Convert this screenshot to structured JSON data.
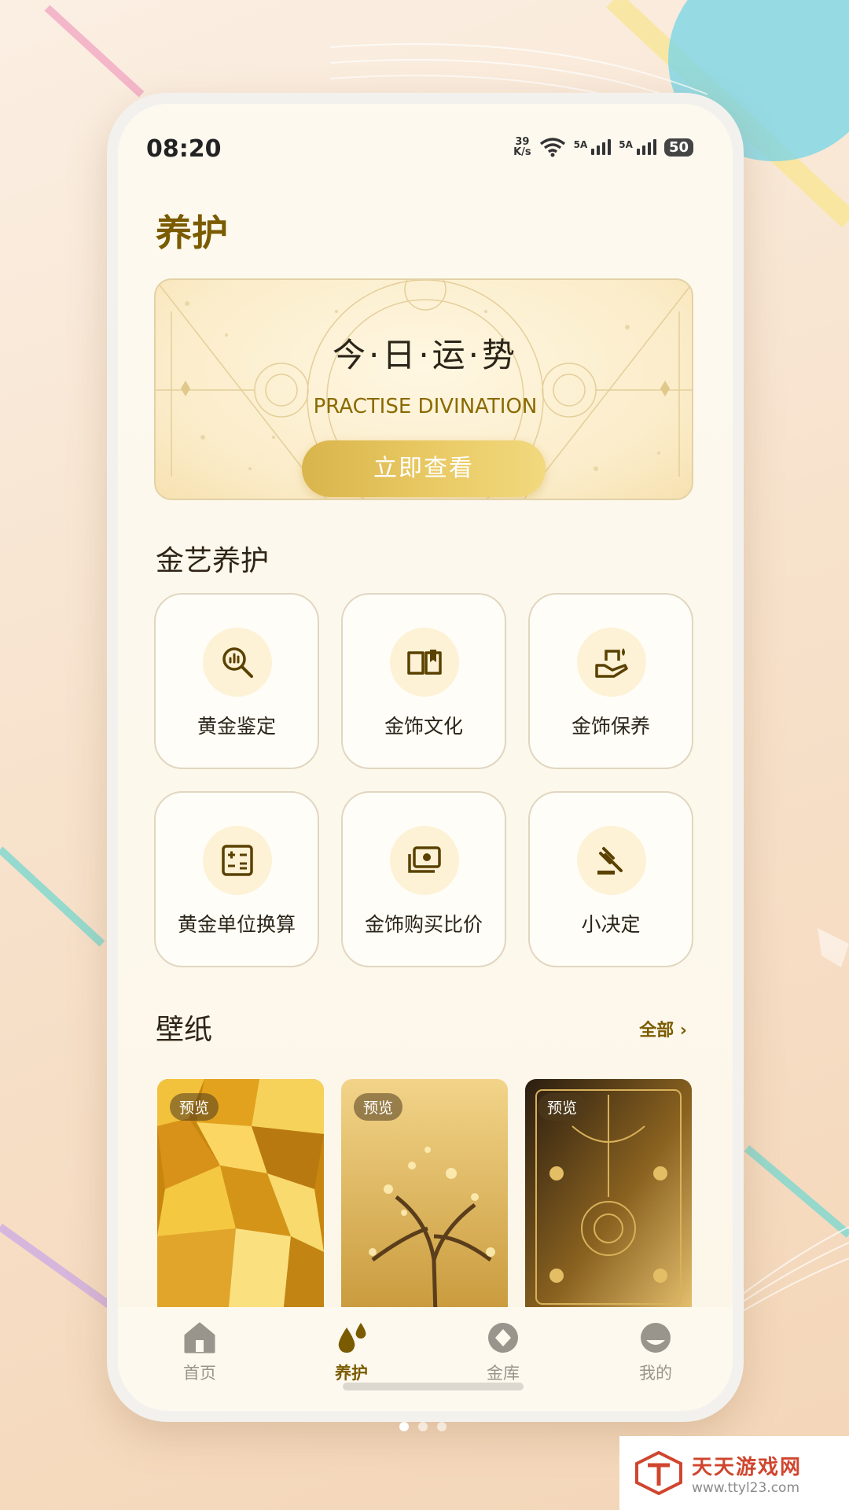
{
  "status_bar": {
    "time": "08:20",
    "net_speed_value": "39",
    "net_speed_unit": "K/s",
    "signal1_label": "5A",
    "signal2_label": "5A",
    "battery": "50"
  },
  "page": {
    "title": "养护"
  },
  "banner": {
    "title": "今·日·运·势",
    "subtitle": "PRACTISE DIVINATION",
    "button_label": "立即查看"
  },
  "care_section": {
    "title": "金艺养护",
    "items": [
      {
        "label": "黄金鉴定",
        "icon": "magnifier-chart-icon"
      },
      {
        "label": "金饰文化",
        "icon": "open-book-icon"
      },
      {
        "label": "金饰保养",
        "icon": "hand-care-icon"
      },
      {
        "label": "黄金单位换算",
        "icon": "calculator-icon"
      },
      {
        "label": "金饰购买比价",
        "icon": "money-icon"
      },
      {
        "label": "小决定",
        "icon": "gavel-icon"
      }
    ]
  },
  "wallpaper_section": {
    "title": "壁纸",
    "more_label": "全部",
    "items": [
      {
        "tag": "预览",
        "theme": "gold-nuggets"
      },
      {
        "tag": "预览",
        "theme": "golden-tree"
      },
      {
        "tag": "预览",
        "theme": "gold-ornament-card"
      }
    ]
  },
  "tabbar": {
    "tabs": [
      {
        "label": "首页",
        "icon": "home-icon",
        "active": false
      },
      {
        "label": "养护",
        "icon": "drops-icon",
        "active": true
      },
      {
        "label": "金库",
        "icon": "diamond-coin-icon",
        "active": false
      },
      {
        "label": "我的",
        "icon": "profile-icon",
        "active": false
      }
    ]
  },
  "watermark": {
    "name": "天天游戏网",
    "url": "www.ttyl23.com"
  },
  "colors": {
    "accent": "#7a5b00",
    "gold": "#e8c862",
    "background": "#fdf9ef"
  }
}
